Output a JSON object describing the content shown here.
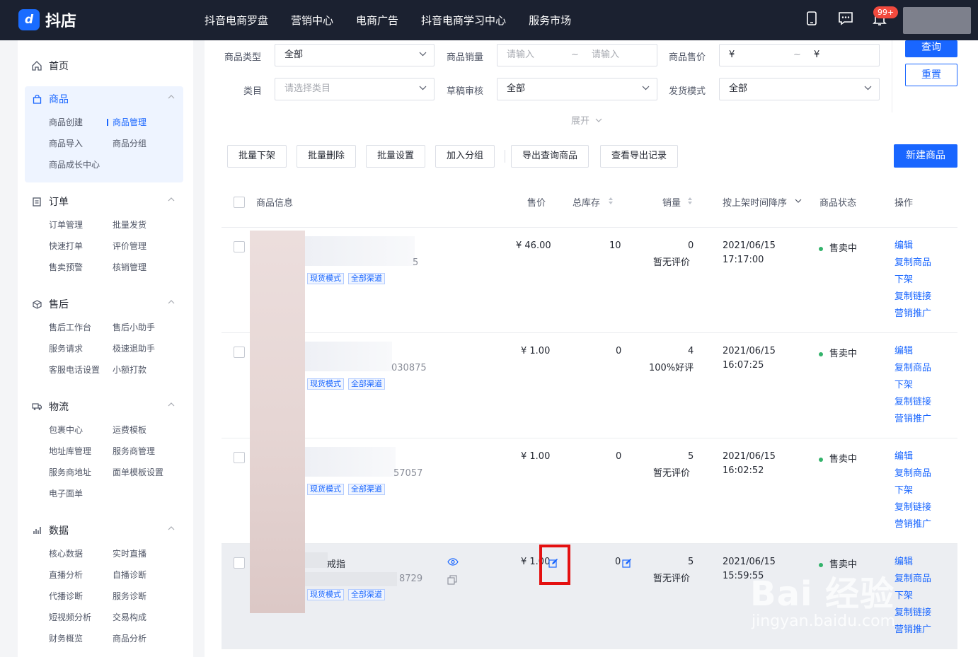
{
  "app": {
    "name": "抖店",
    "logo_letter": "d"
  },
  "topnav": [
    "抖音电商罗盘",
    "营销中心",
    "电商广告",
    "抖音电商学习中心",
    "服务市场"
  ],
  "notifications": {
    "badge": "99+"
  },
  "sidebar": {
    "home": "首页",
    "groups": [
      {
        "title": "商品",
        "items": [
          "商品创建",
          "商品管理",
          "商品导入",
          "商品分组",
          "商品成长中心"
        ],
        "current": "商品管理"
      },
      {
        "title": "订单",
        "items": [
          "订单管理",
          "批量发货",
          "快速打单",
          "评价管理",
          "售卖预警",
          "核销管理"
        ]
      },
      {
        "title": "售后",
        "items": [
          "售后工作台",
          "售后小助手",
          "服务请求",
          "极速退助手",
          "客服电话设置",
          "小额打款"
        ]
      },
      {
        "title": "物流",
        "items": [
          "包裹中心",
          "运费模板",
          "地址库管理",
          "服务商管理",
          "服务商地址",
          "面单模板设置",
          "电子面单"
        ]
      },
      {
        "title": "数据",
        "items": [
          "核心数据",
          "实时直播",
          "直播分析",
          "自播诊断",
          "代播诊断",
          "服务诊断",
          "短视频分析",
          "交易构成",
          "财务概览",
          "商品分析"
        ]
      }
    ]
  },
  "filters": {
    "type_label": "商品类型",
    "type_value": "全部",
    "sales_label": "商品销量",
    "sales_min_ph": "请输入",
    "sales_max_ph": "请输入",
    "range_sep": "~",
    "price_label": "商品售价",
    "currency": "¥",
    "category_label": "类目",
    "category_ph": "请选择类目",
    "draft_label": "草稿审核",
    "draft_value": "全部",
    "ship_label": "发货模式",
    "ship_value": "全部",
    "expand": "展开",
    "query": "查询",
    "reset": "重置"
  },
  "toolbar": {
    "buttons": [
      "批量下架",
      "批量删除",
      "批量设置",
      "加入分组",
      "导出查询商品",
      "查看导出记录"
    ],
    "new": "新建商品"
  },
  "table": {
    "headers": {
      "info": "商品信息",
      "price": "售价",
      "stock": "总库存",
      "sales": "销量",
      "time": "按上架时间降序",
      "status": "商品状态",
      "ops": "操作"
    },
    "tags": [
      "现货模式",
      "全部渠道"
    ],
    "ops": [
      "编辑",
      "复制商品",
      "下架",
      "复制链接",
      "营销推广"
    ],
    "rows": [
      {
        "id_tail": "5",
        "name": "",
        "price": "¥ 46.00",
        "stock": "10",
        "sales": "0",
        "review": "暂无评价",
        "date": "2021/06/15",
        "time": "17:17:00",
        "status": "售卖中"
      },
      {
        "id_tail": "030875",
        "name": "",
        "price": "¥ 1.00",
        "stock": "0",
        "sales": "4",
        "review": "100%好评",
        "date": "2021/06/15",
        "time": "16:07:25",
        "status": "售卖中"
      },
      {
        "id_tail": "57057",
        "name": "",
        "price": "¥ 1.00",
        "stock": "0",
        "sales": "5",
        "review": "暂无评价",
        "date": "2021/06/15",
        "time": "16:02:52",
        "status": "售卖中"
      },
      {
        "id_tail": "8729",
        "name": "戒指",
        "price": "¥ 1.00",
        "stock": "0",
        "sales": "5",
        "review": "暂无评价",
        "date": "2021/06/15",
        "time": "15:59:55",
        "status": "售卖中"
      }
    ]
  },
  "watermark": {
    "main": "Bai 经验",
    "sub": "jingyan.baidu.com"
  },
  "colors": {
    "primary": "#1966ff",
    "topbar": "#1b2130",
    "status_green": "#33b36b",
    "highlight": "#e41010"
  }
}
